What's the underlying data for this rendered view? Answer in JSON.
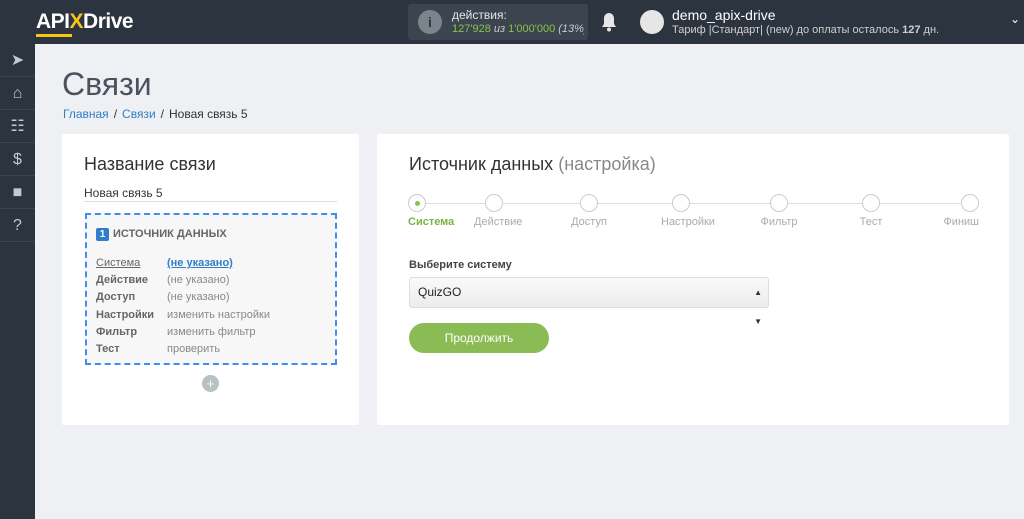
{
  "header": {
    "logo_a": "API",
    "logo_x": "X",
    "logo_b": "Drive",
    "actions_label": "действия:",
    "actions_used": "127'928",
    "actions_of": "из",
    "actions_total": "1'000'000",
    "actions_pct": "(13%)",
    "username": "demo_apix-drive",
    "tariff_prefix": "Тариф |Стандарт| (new) до оплаты осталось ",
    "tariff_days": "127",
    "tariff_suffix": " дн."
  },
  "sidebar": {
    "items": [
      {
        "icon": "arrow-right-circle-icon"
      },
      {
        "icon": "home-icon"
      },
      {
        "icon": "sitemap-icon"
      },
      {
        "icon": "dollar-icon"
      },
      {
        "icon": "briefcase-icon"
      },
      {
        "icon": "question-icon"
      }
    ]
  },
  "page": {
    "title": "Связи",
    "breadcrumb": [
      "Главная",
      "Связи",
      "Новая связь 5"
    ]
  },
  "left": {
    "title": "Название связи",
    "name_value": "Новая связь 5",
    "source": {
      "num": "1",
      "title": "ИСТОЧНИК ДАННЫХ",
      "rows": [
        {
          "k": "Система",
          "v": "(не указано)"
        },
        {
          "k": "Действие",
          "v": "(не указано)"
        },
        {
          "k": "Доступ",
          "v": "(не указано)"
        },
        {
          "k": "Настройки",
          "v": "изменить настройки"
        },
        {
          "k": "Фильтр",
          "v": "изменить фильтр"
        },
        {
          "k": "Тест",
          "v": "проверить"
        }
      ]
    },
    "add": "+"
  },
  "right": {
    "title": "Источник данных",
    "title_sub": "(настройка)",
    "steps": [
      "Система",
      "Действие",
      "Доступ",
      "Настройки",
      "Фильтр",
      "Тест",
      "Финиш"
    ],
    "active_step": 0,
    "select_label": "Выберите систему",
    "select_value": "QuizGO",
    "continue": "Продолжить"
  },
  "colors": {
    "accent": "#8bbb55",
    "link": "#2f7fc8",
    "sidebar": "#2c3440"
  }
}
